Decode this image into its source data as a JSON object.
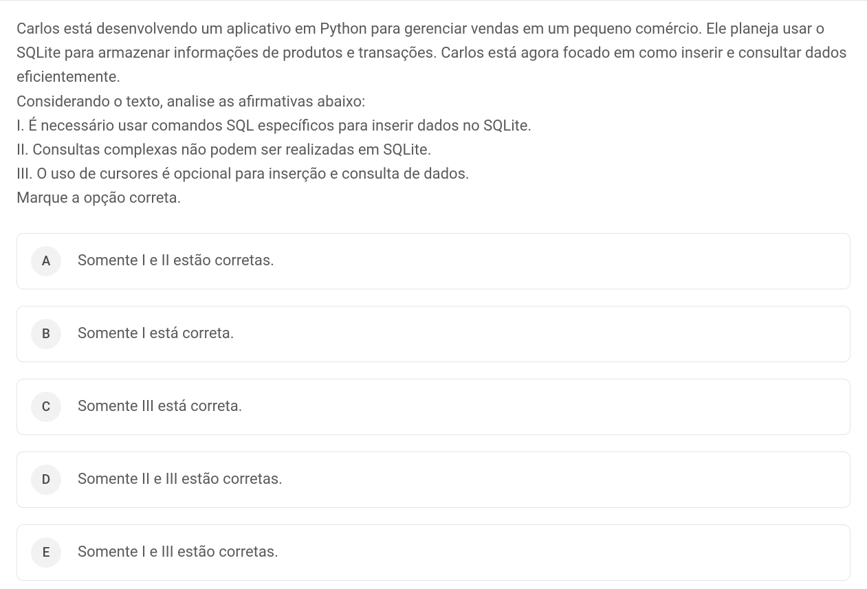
{
  "question": {
    "paragraphs": [
      "Carlos está desenvolvendo um aplicativo em Python para gerenciar vendas em um pequeno comércio. Ele planeja usar o SQLite para armazenar informações de produtos e transações. Carlos está agora focado em como inserir e consultar dados eficientemente.",
      "Considerando o texto, analise as afirmativas abaixo:",
      "I. É necessário usar comandos SQL específicos para inserir dados no SQLite.",
      "II. Consultas complexas não podem ser realizadas em SQLite.",
      "III. O uso de cursores é opcional para inserção e consulta de dados.",
      "Marque a opção correta."
    ]
  },
  "options": [
    {
      "letter": "A",
      "text": "Somente I e II estão corretas."
    },
    {
      "letter": "B",
      "text": "Somente I está correta."
    },
    {
      "letter": "C",
      "text": "Somente III está correta."
    },
    {
      "letter": "D",
      "text": "Somente II e III estão corretas."
    },
    {
      "letter": "E",
      "text": "Somente I e III estão corretas."
    }
  ]
}
